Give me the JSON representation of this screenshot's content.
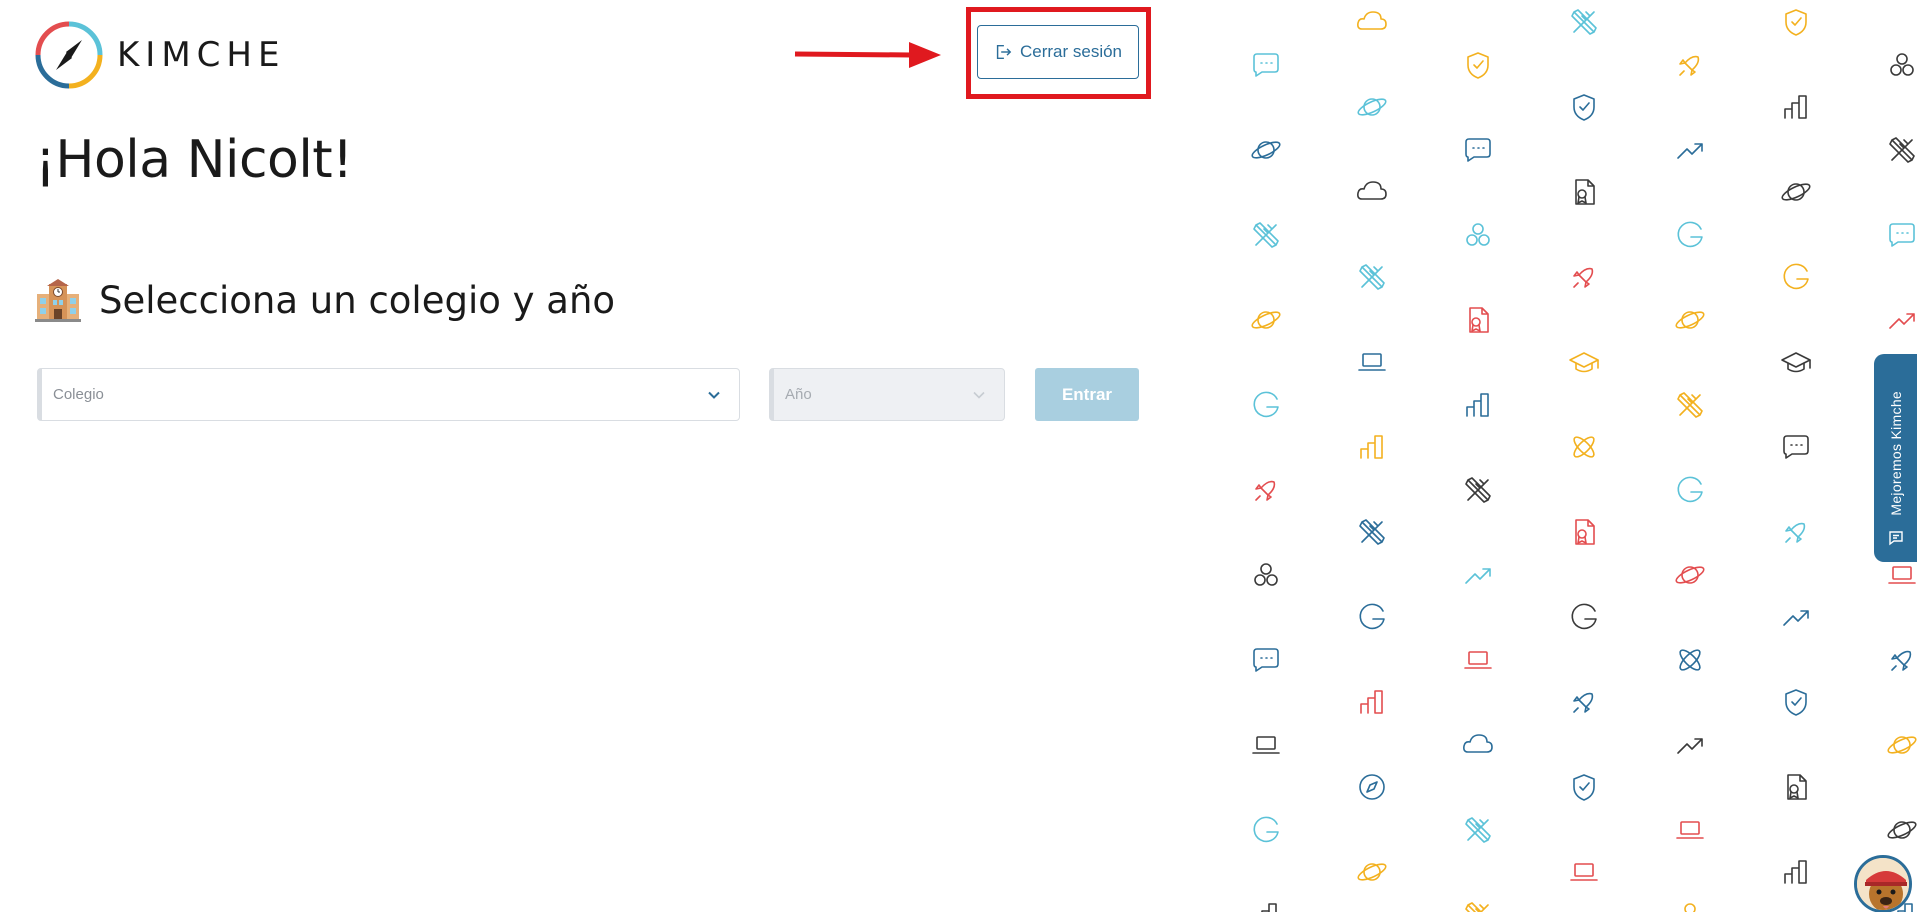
{
  "header": {
    "logo_text": "KIMCHE",
    "logout_label": "Cerrar sesión"
  },
  "main": {
    "greeting": "¡Hola Nicolt!",
    "section_title": "Selecciona un colegio y año",
    "school_select": {
      "placeholder": "Colegio"
    },
    "year_select": {
      "placeholder": "Año",
      "disabled": true
    },
    "enter_label": "Entrar"
  },
  "feedback_tab": {
    "label": "Mejoremos Kimche"
  },
  "colors": {
    "primary": "#2b6d99",
    "disabled_button": "#a9cfe0",
    "annotation": "#e0191f",
    "icon_colors": [
      "#3a3a3a",
      "#2b6d99",
      "#5bc2d8",
      "#e34d4f",
      "#f3b11f"
    ]
  },
  "pattern_icons": [
    "trending-up",
    "planet",
    "bar-chart",
    "shield-check",
    "rocket",
    "compass",
    "pencil-ruler",
    "chat",
    "google",
    "circles",
    "laptop",
    "certificate",
    "graduation-cap",
    "atom",
    "cloud"
  ]
}
